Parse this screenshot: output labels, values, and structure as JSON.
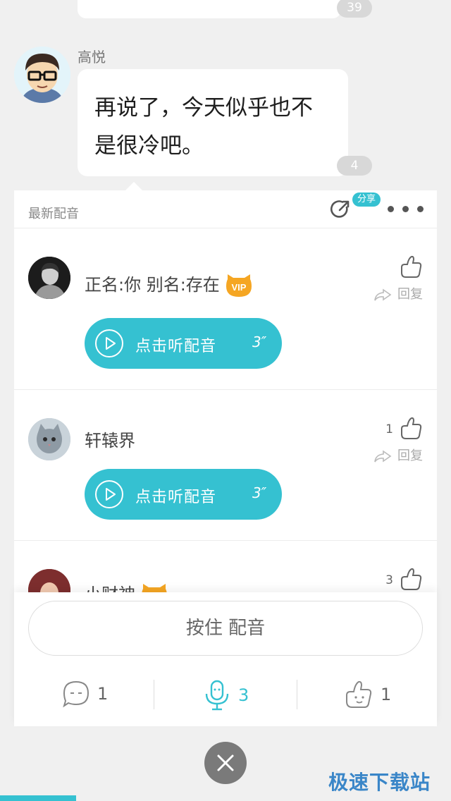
{
  "top_message": {
    "reply_count": "39"
  },
  "message": {
    "author": "高悦",
    "text": "再说了，今天似乎也不是很冷吧。",
    "reply_count": "4"
  },
  "panel": {
    "title": "最新配音",
    "share_label": "分享"
  },
  "dubs": [
    {
      "user": "正名:你 别名:存在",
      "vip": true,
      "play_label": "点击听配音",
      "duration": "3″",
      "likes": "",
      "reply_label": "回复"
    },
    {
      "user": "轩辕界",
      "vip": false,
      "play_label": "点击听配音",
      "duration": "3″",
      "likes": "1",
      "reply_label": "回复"
    },
    {
      "user": "小财神",
      "vip": true,
      "likes": "3"
    }
  ],
  "bottom": {
    "hold_label": "按住 配音",
    "comments": "1",
    "dubs": "3",
    "likes": "1"
  },
  "watermark": "极速下载站",
  "colors": {
    "accent": "#35c1d1",
    "vip": "#f5a623",
    "watermark": "#3a86c8"
  }
}
